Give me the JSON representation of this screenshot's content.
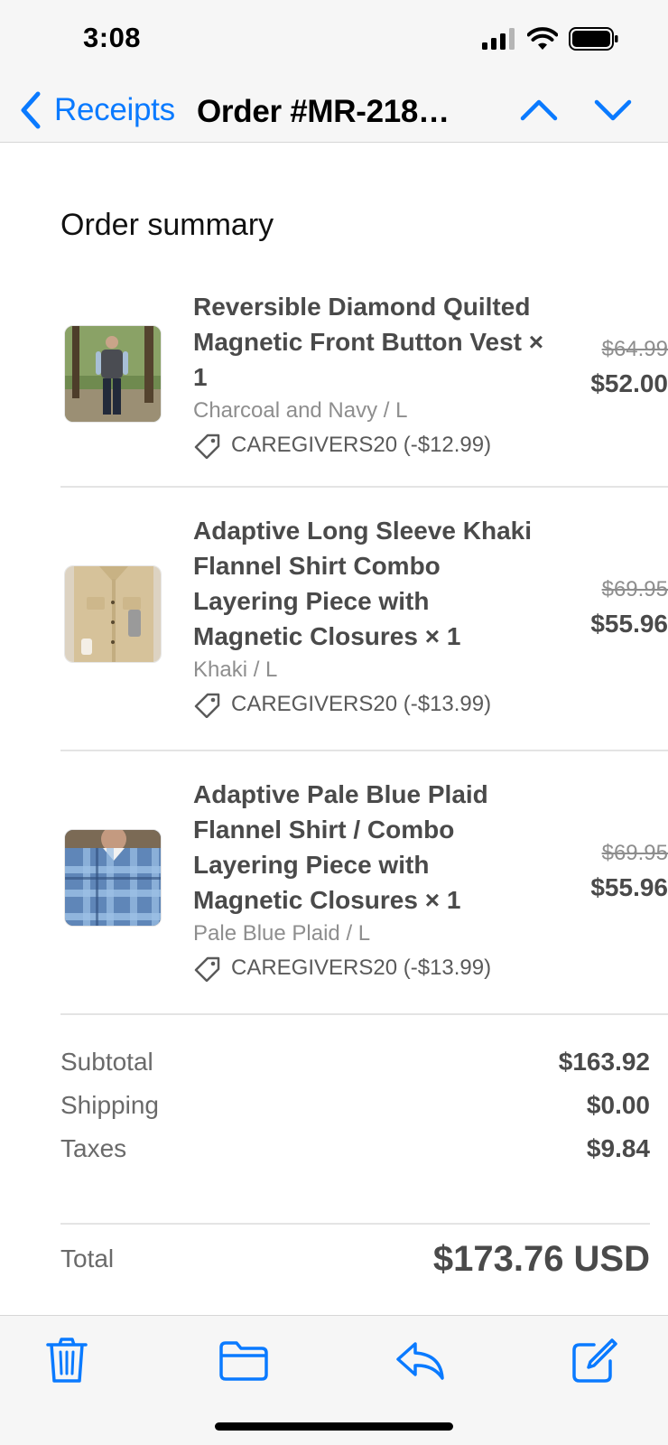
{
  "status_bar": {
    "time": "3:08"
  },
  "nav": {
    "back_label": "Receipts",
    "title": "Order #MR-218…"
  },
  "summary": {
    "title": "Order summary",
    "items": [
      {
        "name": "Reversible Diamond Quilted Magnetic Front Button Vest × 1",
        "variant": "Charcoal and Navy / L",
        "discount": "CAREGIVERS20 (-$12.99)",
        "original_price": "$64.99",
        "price": "$52.00",
        "image": "vest-photo"
      },
      {
        "name": "Adaptive Long Sleeve Khaki Flannel Shirt Combo Layering Piece with Magnetic Closures × 1",
        "variant": "Khaki / L",
        "discount": "CAREGIVERS20 (-$13.99)",
        "original_price": "$69.95",
        "price": "$55.96",
        "image": "khaki-shirt-photo"
      },
      {
        "name": "Adaptive Pale Blue Plaid Flannel Shirt / Combo Layering Piece with Magnetic Closures × 1",
        "variant": "Pale Blue Plaid / L",
        "discount": "CAREGIVERS20 (-$13.99)",
        "original_price": "$69.95",
        "price": "$55.96",
        "image": "plaid-shirt-photo"
      }
    ],
    "subtotal_label": "Subtotal",
    "subtotal": "$163.92",
    "shipping_label": "Shipping",
    "shipping": "$0.00",
    "taxes_label": "Taxes",
    "taxes": "$9.84",
    "total_label": "Total",
    "total": "$173.76 USD"
  },
  "toolbar": {
    "icons": [
      "trash-icon",
      "folder-icon",
      "reply-icon",
      "compose-icon"
    ]
  },
  "colors": {
    "accent": "#0a7aff",
    "bar_background": "#f6f6f6",
    "text_strong": "#4a4a4a",
    "text_muted": "#8e8e8e"
  }
}
